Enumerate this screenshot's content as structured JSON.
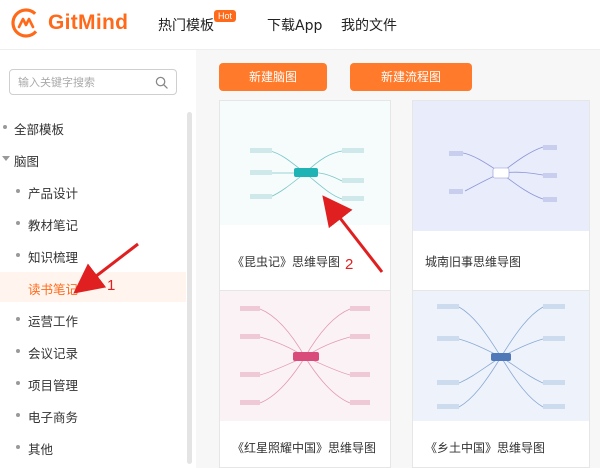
{
  "header": {
    "logo_text": "GitMind",
    "nav": [
      {
        "label": "热门模板"
      },
      {
        "label": "下载App"
      },
      {
        "label": "我的文件"
      }
    ],
    "hot_badge": "Hot"
  },
  "search": {
    "placeholder": "输入关键字搜索"
  },
  "sidebar": {
    "all_templates": "全部模板",
    "mindmap": "脑图",
    "items": [
      {
        "label": "产品设计"
      },
      {
        "label": "教材笔记"
      },
      {
        "label": "知识梳理"
      },
      {
        "label": "读书笔记",
        "active": true
      },
      {
        "label": "运营工作"
      },
      {
        "label": "会议记录"
      },
      {
        "label": "项目管理"
      },
      {
        "label": "电子商务"
      },
      {
        "label": "其他"
      }
    ]
  },
  "buttons": {
    "new_mindmap": "新建脑图",
    "new_flowchart": "新建流程图"
  },
  "cards": [
    {
      "title": "《昆虫记》思维导图"
    },
    {
      "title": "城南旧事思维导图"
    },
    {
      "title": "《红星照耀中国》思维导图"
    },
    {
      "title": "《乡土中国》思维导图"
    }
  ],
  "annotations": {
    "one": "1",
    "two": "2"
  },
  "colors": {
    "accent": "#ff6a1a",
    "annotation": "#e02020"
  }
}
